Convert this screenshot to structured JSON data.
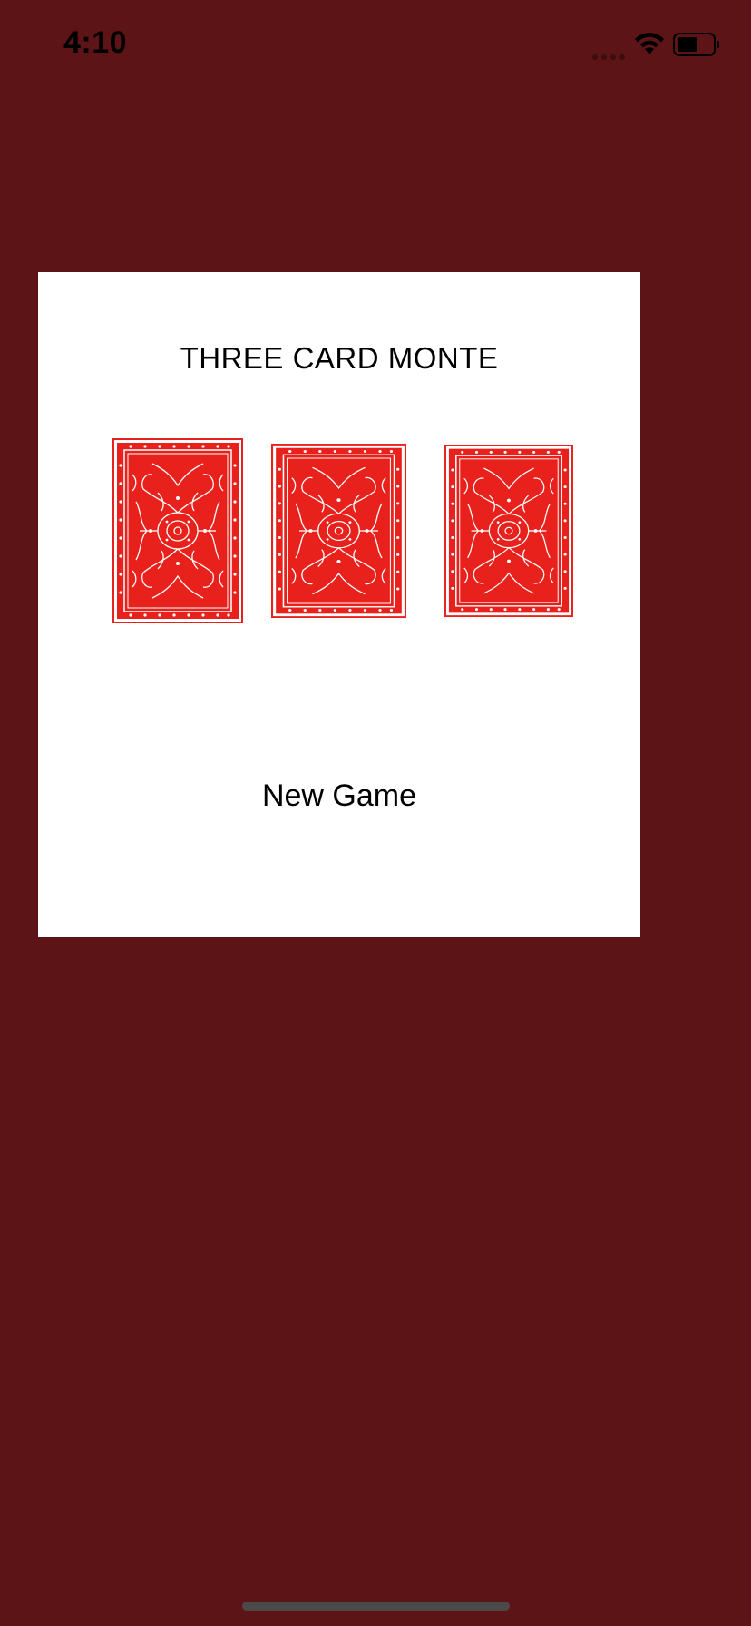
{
  "status_bar": {
    "time": "4:10",
    "icons": [
      "signal-icon",
      "wifi-icon",
      "battery-icon"
    ],
    "battery_level": 0.6
  },
  "game": {
    "title": "THREE CARD MONTE",
    "cards": [
      {
        "name": "card-back-1",
        "face": "down"
      },
      {
        "name": "card-back-2",
        "face": "down"
      },
      {
        "name": "card-back-3",
        "face": "down"
      }
    ],
    "new_game_label": "New Game"
  },
  "colors": {
    "background": "#5c1416",
    "panel": "#ffffff",
    "card_red": "#e8211c"
  }
}
